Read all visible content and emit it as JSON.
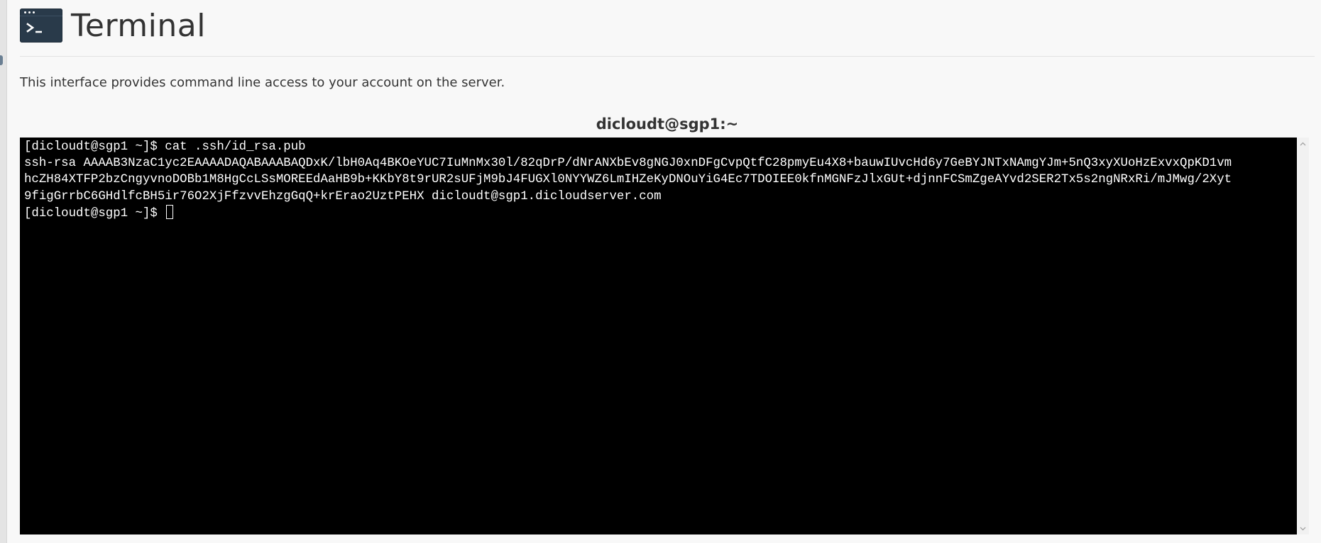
{
  "header": {
    "title": "Terminal",
    "icon": "terminal-icon"
  },
  "description": "This interface provides command line access to your account on the server.",
  "host_label": "dicloudt@sgp1:~",
  "terminal": {
    "lines": [
      "[dicloudt@sgp1 ~]$ cat .ssh/id_rsa.pub",
      "ssh-rsa AAAAB3NzaC1yc2EAAAADAQABAAABAQDxK/lbH0Aq4BKOeYUC7IuMnMx30l/82qDrP/dNrANXbEv8gNGJ0xnDFgCvpQtfC28pmyEu4X8+bauwIUvcHd6y7GeBYJNTxNAmgYJm+5nQ3xyXUoHzExvxQpKD1vm",
      "hcZH84XTFP2bzCngyvnoDOBb1M8HgCcLSsMOREEdAaHB9b+KKbY8t9rUR2sUFjM9bJ4FUGXl0NYYWZ6LmIHZeKyDNOuYiG4Ec7TDOIEE0kfnMGNFzJlxGUt+djnnFCSmZgeAYvd2SER2Tx5s2ngNRxRi/mJMwg/2Xyt",
      "9figGrrbC6GHdlfcBH5ir76O2XjFfzvvEhzgGqQ+krErao2UztPEHX dicloudt@sgp1.dicloudserver.com"
    ],
    "prompt": "[dicloudt@sgp1 ~]$ "
  },
  "colors": {
    "page_background": "#f8f8f8",
    "terminal_background": "#000000",
    "terminal_text": "#ffffff",
    "icon_background": "#293a4a",
    "title_text": "#333333"
  }
}
